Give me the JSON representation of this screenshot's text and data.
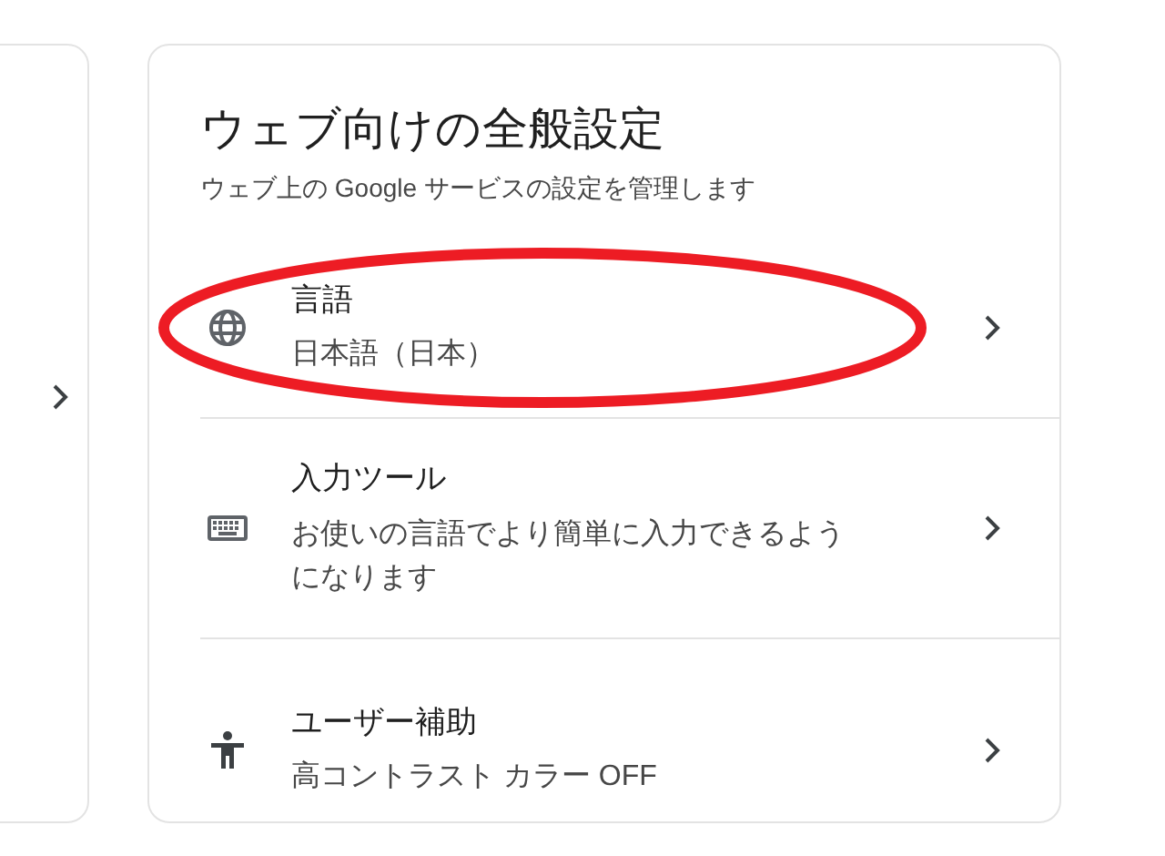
{
  "card": {
    "title": "ウェブ向けの全般設定",
    "subtitle": "ウェブ上の Google サービスの設定を管理します"
  },
  "items": [
    {
      "kind": "language",
      "label": "言語",
      "value": "日本語（日本）",
      "highlighted": true
    },
    {
      "kind": "keyboard",
      "label": "入力ツール",
      "value": "お使いの言語でより簡単に入力できるようになります",
      "highlighted": false
    },
    {
      "kind": "accessibility",
      "label": "ユーザー補助",
      "value": "高コントラスト カラー OFF",
      "highlighted": false
    }
  ]
}
